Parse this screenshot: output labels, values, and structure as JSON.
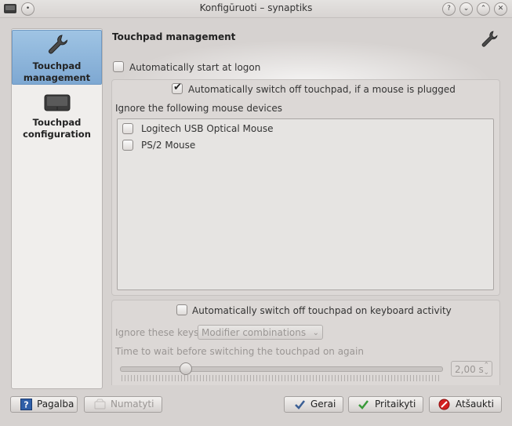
{
  "window": {
    "title": "Konfigūruoti – synaptiks"
  },
  "titlebar_buttons": [
    {
      "name": "help-button",
      "glyph": "?"
    },
    {
      "name": "minimize-button",
      "glyph": "⌄"
    },
    {
      "name": "maximize-button",
      "glyph": "⌃"
    },
    {
      "name": "close-button",
      "glyph": "✕"
    }
  ],
  "sidebar": {
    "items": [
      {
        "label_line1": "Touchpad",
        "label_line2": "management",
        "icon": "wrench-icon",
        "active": true
      },
      {
        "label_line1": "Touchpad",
        "label_line2": "configuration",
        "icon": "touchpad-icon",
        "active": false
      }
    ]
  },
  "main": {
    "title": "Touchpad management",
    "auto_start": {
      "label": "Automatically start at logon",
      "checked": false
    },
    "auto_switch_mouse": {
      "label": "Automatically switch off touchpad, if a mouse is plugged",
      "checked": true
    },
    "ignore_label": "Ignore the following mouse devices",
    "devices": [
      {
        "label": "Logitech USB Optical Mouse",
        "checked": false
      },
      {
        "label": "PS/2 Mouse",
        "checked": false
      }
    ],
    "keyboard_activity": {
      "label": "Automatically switch off touchpad on keyboard activity",
      "checked": false
    },
    "ignore_keys_label": "Ignore these keys",
    "ignore_keys_value": "Modifier combinations",
    "wait_label": "Time to wait before switching the touchpad on again",
    "wait_value": "2,00 s",
    "wait_fraction": 0.2
  },
  "buttons": {
    "help": "Pagalba",
    "defaults": "Numatyti",
    "ok": "Gerai",
    "apply": "Pritaikyti",
    "cancel": "Atšaukti"
  }
}
